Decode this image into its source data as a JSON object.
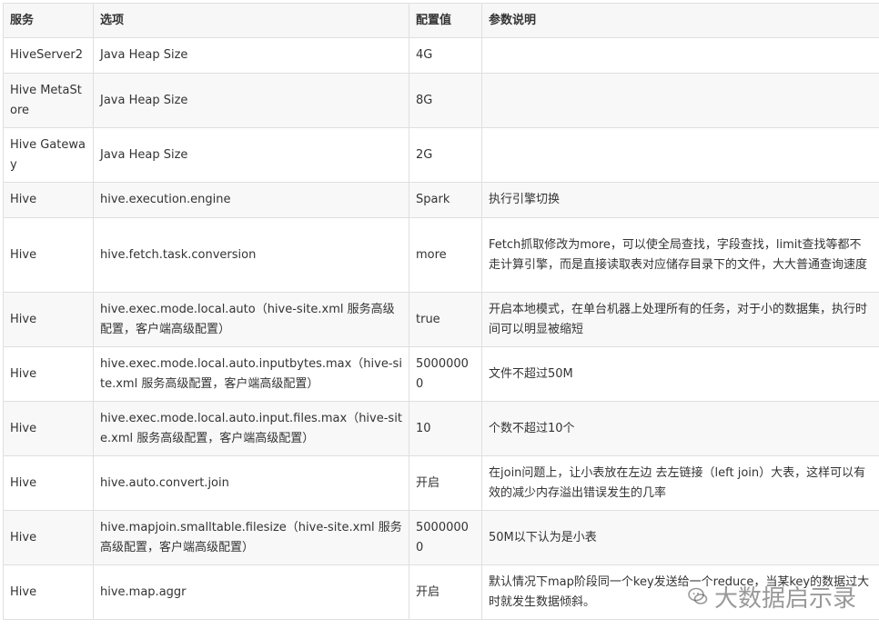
{
  "table": {
    "headers": [
      "服务",
      "选项",
      "配置值",
      "参数说明"
    ],
    "rows": [
      {
        "service": "HiveServer2",
        "option": "Java Heap Size",
        "value": "4G",
        "desc": ""
      },
      {
        "service": "Hive MetaStore",
        "option": "Java Heap Size",
        "value": "8G",
        "desc": ""
      },
      {
        "service": "Hive Gateway",
        "option": "Java Heap Size",
        "value": "2G",
        "desc": ""
      },
      {
        "service": "Hive",
        "option": "hive.execution.engine",
        "value": "Spark",
        "desc": "执行引擎切换"
      },
      {
        "service": "Hive",
        "option": "hive.fetch.task.conversion",
        "value": "more",
        "desc": "Fetch抓取修改为more，可以使全局查找，字段查找，limit查找等都不走计算引擎，而是直接读取表对应储存目录下的文件，大大普通查询速度"
      },
      {
        "service": "Hive",
        "option": "hive.exec.mode.local.auto（hive-site.xml 服务高级配置，客户端高级配置）",
        "value": "true",
        "desc": "开启本地模式，在单台机器上处理所有的任务，对于小的数据集，执行时间可以明显被缩短"
      },
      {
        "service": "Hive",
        "option": "hive.exec.mode.local.auto.inputbytes.max（hive-site.xml 服务高级配置，客户端高级配置）",
        "value": "50000000",
        "desc": "文件不超过50M"
      },
      {
        "service": "Hive",
        "option": "hive.exec.mode.local.auto.input.files.max（hive-site.xml 服务高级配置，客户端高级配置）",
        "value": "10",
        "desc": "个数不超过10个"
      },
      {
        "service": "Hive",
        "option": "hive.auto.convert.join",
        "value": "开启",
        "desc": "在join问题上，让小表放在左边 去左链接（left join）大表，这样可以有效的减少内存溢出错误发生的几率"
      },
      {
        "service": "Hive",
        "option": "hive.mapjoin.smalltable.filesize（hive-site.xml 服务高级配置，客户端高级配置）",
        "value": "50000000",
        "desc": "50M以下认为是小表"
      },
      {
        "service": "Hive",
        "option": "hive.map.aggr",
        "value": "开启",
        "desc": "默认情况下map阶段同一个key发送给一个reduce，当某key的数据过大时就发生数据倾斜。"
      }
    ]
  },
  "watermark": {
    "text": "大数据启示录",
    "icon": "wechat-icon"
  }
}
